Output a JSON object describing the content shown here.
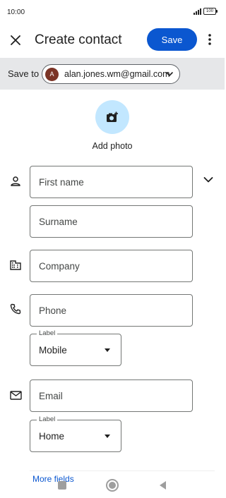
{
  "status_bar": {
    "time": "10:00",
    "battery": "100"
  },
  "app_bar": {
    "title": "Create contact",
    "save_label": "Save"
  },
  "save_to": {
    "label": "Save to",
    "avatar_letter": "A",
    "email": "alan.jones.wm@gmail.com"
  },
  "photo": {
    "label": "Add photo"
  },
  "fields": {
    "first_name": "First name",
    "surname": "Surname",
    "company": "Company",
    "phone": "Phone",
    "email": "Email"
  },
  "phone_label": {
    "caption": "Label",
    "value": "Mobile"
  },
  "email_label": {
    "caption": "Label",
    "value": "Home"
  },
  "more_fields": "More fields",
  "colors": {
    "accent": "#0b57d0",
    "photo_bg": "#c2e7ff",
    "save_to_bg": "#e6e7e9",
    "avatar": "#7b3426"
  }
}
